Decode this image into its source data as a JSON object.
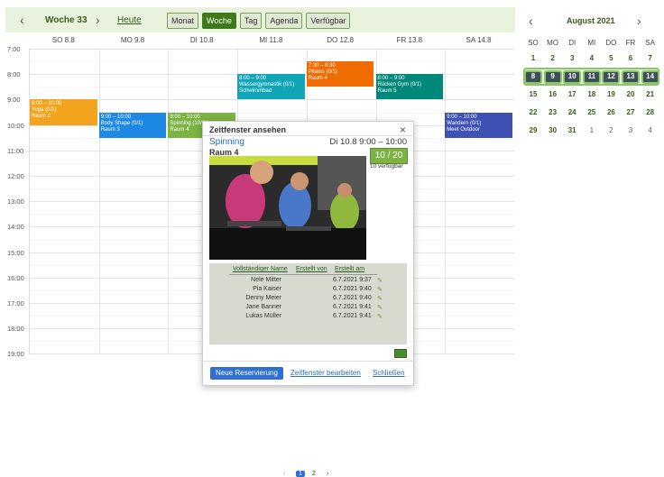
{
  "toolbar": {
    "week_label": "Woche 33",
    "today_label": "Heute",
    "views": [
      "Monat",
      "Woche",
      "Tag",
      "Agenda",
      "Verfügbar"
    ],
    "active_view": "Woche"
  },
  "days": [
    "SO 8.8",
    "MO 9.8",
    "DI 10.8",
    "MI 11.8",
    "DO 12.8",
    "FR 13.8",
    "SA 14.8"
  ],
  "times": [
    "7:00",
    "8:00",
    "9:00",
    "10:00",
    "11:00",
    "12:00",
    "13:00",
    "14:00",
    "15:00",
    "16:00",
    "17:00",
    "18:00",
    "19:00"
  ],
  "events": [
    {
      "day": 0,
      "start": 9.0,
      "end": 10.0,
      "time": "9:00 – 10:00",
      "title": "Yoga (0/1)",
      "room": "Raum 1",
      "color": "#f2a41e"
    },
    {
      "day": 1,
      "start": 9.5,
      "end": 10.5,
      "time": "9:00 – 10:00",
      "title": "Body Shape (0/1)",
      "room": "Raum 3",
      "color": "#1e88e5"
    },
    {
      "day": 2,
      "start": 9.5,
      "end": 10.5,
      "time": "9:00 – 10:00",
      "title": "Spinning (10/20)",
      "room": "Raum 4",
      "color": "#7cb342"
    },
    {
      "day": 3,
      "start": 8.0,
      "end": 9.0,
      "time": "8:00 – 9:00",
      "title": "Wassergymnastik (0/1)",
      "room": "Schwimmbad",
      "color": "#11a5b8"
    },
    {
      "day": 4,
      "start": 7.5,
      "end": 8.5,
      "time": "7:30 – 8:30",
      "title": "Pilates (0/1)",
      "room": "Raum 4",
      "color": "#ef6c00"
    },
    {
      "day": 5,
      "start": 8.0,
      "end": 9.0,
      "time": "8:00 – 9:00",
      "title": "Rücken Gym (0/1)",
      "room": "Raum 5",
      "color": "#00897b"
    },
    {
      "day": 6,
      "start": 9.5,
      "end": 10.5,
      "time": "9:00 – 10:00",
      "title": "Wandern (0/1)",
      "room": "Meet Outdoor",
      "color": "#3f51b5"
    }
  ],
  "mini_calendar": {
    "title": "August 2021",
    "dow": [
      "SO",
      "MO",
      "DI",
      "MI",
      "DO",
      "FR",
      "SA"
    ],
    "weeks": [
      [
        "1",
        "2",
        "3",
        "4",
        "5",
        "6",
        "7"
      ],
      [
        "8",
        "9",
        "10",
        "11",
        "12",
        "13",
        "14"
      ],
      [
        "15",
        "16",
        "17",
        "18",
        "19",
        "20",
        "21"
      ],
      [
        "22",
        "23",
        "24",
        "25",
        "26",
        "27",
        "28"
      ],
      [
        "29",
        "30",
        "31",
        "1",
        "2",
        "3",
        "4"
      ]
    ],
    "selected_week": 1
  },
  "popup": {
    "title": "Zeitfenster ansehen",
    "course": "Spinning",
    "time": "Di 10.8  9:00 – 10:00",
    "room": "Raum 4",
    "capacity": "10 / 20",
    "available": "10 verfügbar",
    "columns": [
      "Vollständiger Name",
      "Erstellt von",
      "Erstellt am"
    ],
    "rows": [
      {
        "name": "Nele Mitter",
        "date": "6.7.2021 9:37"
      },
      {
        "name": "Pia Kaiser",
        "date": "6.7.2021 9:40"
      },
      {
        "name": "Denny Meier",
        "date": "6.7.2021 9:40"
      },
      {
        "name": "Jane Banner",
        "date": "6.7.2021 9:41"
      },
      {
        "name": "Lukas Müller",
        "date": "6.7.2021 9:41"
      }
    ],
    "pages": [
      "1",
      "2"
    ],
    "new_button": "Neue Reservierung",
    "edit_link": "Zeitfenster bearbeiten",
    "close_link": "Schließen"
  }
}
